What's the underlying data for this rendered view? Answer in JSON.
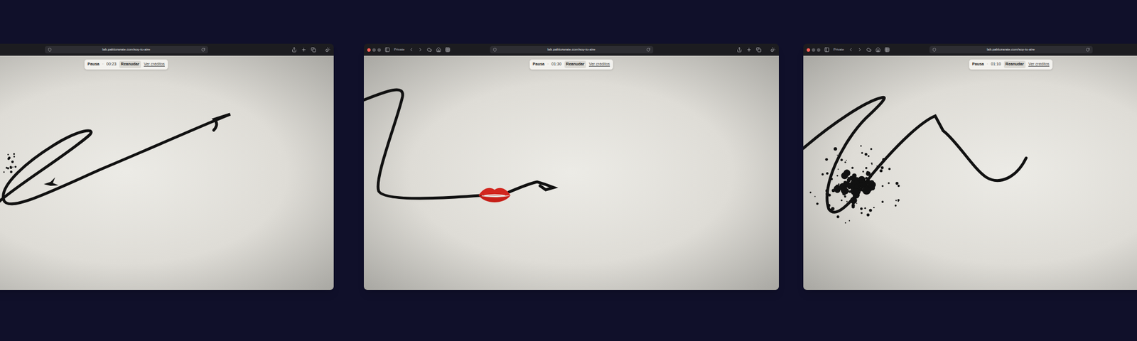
{
  "browser_windows": [
    {
      "private": false,
      "url": "lab.pablozarate.com/soy-tu-aire",
      "scene": "bird",
      "controls": {
        "pause": "Pausa",
        "separator": "·",
        "time": "00:23",
        "resume": "Reanudar",
        "credits": "Ver créditos"
      }
    },
    {
      "private": true,
      "private_label": "Private",
      "url": "lab.pablozarate.com/soy-tu-aire",
      "scene": "kiss",
      "controls": {
        "pause": "Pausa",
        "separator": "·",
        "time": "01:30",
        "resume": "Reanudar",
        "credits": "Ver créditos"
      }
    },
    {
      "private": true,
      "private_label": "Private",
      "url": "lab.pablozarate.com/soy-tu-aire",
      "scene": "splatter",
      "controls": {
        "pause": "Pausa",
        "separator": "·",
        "time": "01:10",
        "resume": "Reanudar",
        "credits": "Ver créditos"
      }
    }
  ]
}
